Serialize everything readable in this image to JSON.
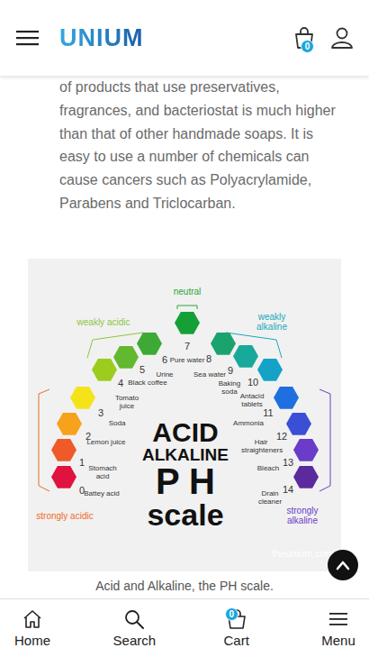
{
  "header": {
    "logo": "UNIUM",
    "cart_badge": "0"
  },
  "article": {
    "text": "of products that use preservatives, fragrances, and bacteriostat is much higher than that of other handmade soaps. It is easy to use a number of chemicals can cause cancers such as Polyacrylamide, Parabens and Triclocarban."
  },
  "figure": {
    "groups": [
      {
        "label": "neutral",
        "color": "#2aa53a"
      },
      {
        "label": "weakly acidic",
        "color": "#8cc63f"
      },
      {
        "label": "weakly alkaline",
        "color": "#19a9b8"
      },
      {
        "label": "strongly acidic",
        "color": "#ef6a24"
      },
      {
        "label": "strongly alkaline",
        "color": "#6a3cc9"
      }
    ],
    "levels": [
      {
        "ph": "0",
        "desc": "Battey acid",
        "color": "#e0123f"
      },
      {
        "ph": "1",
        "desc": "Stomach acid",
        "color": "#ef5a28"
      },
      {
        "ph": "2",
        "desc": "Lemon juice",
        "color": "#f7a21b"
      },
      {
        "ph": "3",
        "desc": "Soda",
        "color": "#f5e31a"
      },
      {
        "ph": "4",
        "desc": "Tomato juice",
        "color": "#9ccc1d"
      },
      {
        "ph": "5",
        "desc": "Black coffee",
        "color": "#62b82e"
      },
      {
        "ph": "6",
        "desc": "Urine",
        "color": "#3daa36"
      },
      {
        "ph": "7",
        "desc": "Pure water",
        "color": "#14a036"
      },
      {
        "ph": "8",
        "desc": "Sea water",
        "color": "#1aa36f"
      },
      {
        "ph": "9",
        "desc": "Baking soda",
        "color": "#17a99a"
      },
      {
        "ph": "10",
        "desc": "Antacid tablets",
        "color": "#14a3c7"
      },
      {
        "ph": "11",
        "desc": "Ammonia",
        "color": "#1f6fe0"
      },
      {
        "ph": "12",
        "desc": "Hair straighteners",
        "color": "#3b4fd6"
      },
      {
        "ph": "13",
        "desc": "Bleach",
        "color": "#6a3cc9"
      },
      {
        "ph": "14",
        "desc": "Drain cleaner",
        "color": "#5b2a9c"
      }
    ],
    "title": [
      "ACID",
      "ALKALINE",
      "P H",
      "scale"
    ],
    "watermark": "theunium.com",
    "caption": "Acid and Alkaline, the PH scale."
  },
  "nav": [
    {
      "label": "Home"
    },
    {
      "label": "Search"
    },
    {
      "label": "Cart",
      "badge": "0"
    },
    {
      "label": "Menu"
    }
  ]
}
